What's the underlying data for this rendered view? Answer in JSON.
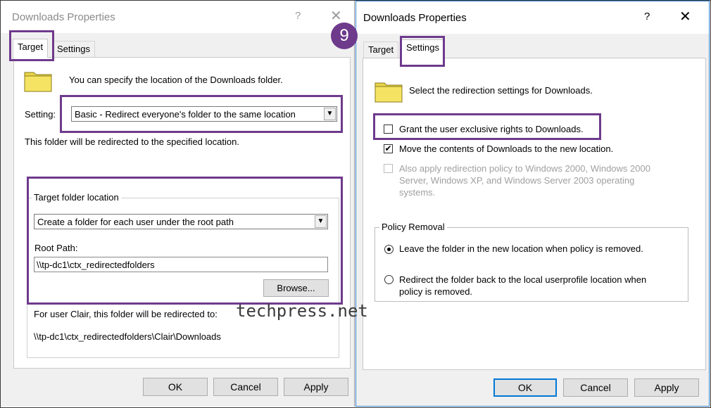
{
  "step_badge": "9",
  "watermark": "techpress.net",
  "accent": "#6e3a8c",
  "left_dialog": {
    "title": "Downloads Properties",
    "help_label": "?",
    "close_label": "✕",
    "tabs": [
      {
        "label": "Target",
        "active": true
      },
      {
        "label": "Settings",
        "active": false
      }
    ],
    "intro_text": "You can specify the location of the Downloads folder.",
    "setting_label": "Setting:",
    "setting_value": "Basic - Redirect everyone's folder to the same location",
    "redirect_note": "This folder will be redirected to the specified location.",
    "target_group": {
      "label": "Target folder location",
      "option_value": "Create a folder for each user under the root path",
      "root_path_label": "Root Path:",
      "root_path_value": "\\\\tp-dc1\\ctx_redirectedfolders",
      "browse_label": "Browse..."
    },
    "example_text": "For user Clair, this folder will be redirected to:",
    "example_path": "\\\\tp-dc1\\ctx_redirectedfolders\\Clair\\Downloads",
    "buttons": {
      "ok": "OK",
      "cancel": "Cancel",
      "apply": "Apply"
    }
  },
  "right_dialog": {
    "title": "Downloads Properties",
    "help_label": "?",
    "close_label": "✕",
    "tabs": [
      {
        "label": "Target",
        "active": false
      },
      {
        "label": "Settings",
        "active": true
      }
    ],
    "intro_text": "Select the redirection settings for Downloads.",
    "grant_label": "Grant the user exclusive rights to Downloads.",
    "grant_checked": false,
    "move_label": "Move the contents of Downloads to the new location.",
    "move_checked": true,
    "also_apply_line1": "Also apply redirection policy to Windows 2000, Windows 2000",
    "also_apply_line2": "Server, Windows XP, and Windows Server 2003 operating",
    "also_apply_line3": "systems.",
    "also_apply_checked": false,
    "policy_removal": {
      "label": "Policy Removal",
      "option1": "Leave the folder in the new location when policy is removed.",
      "option2_line1": "Redirect the folder back to the local userprofile location when",
      "option2_line2": "policy is removed.",
      "selected": "option1"
    },
    "buttons": {
      "ok": "OK",
      "cancel": "Cancel",
      "apply": "Apply"
    }
  }
}
